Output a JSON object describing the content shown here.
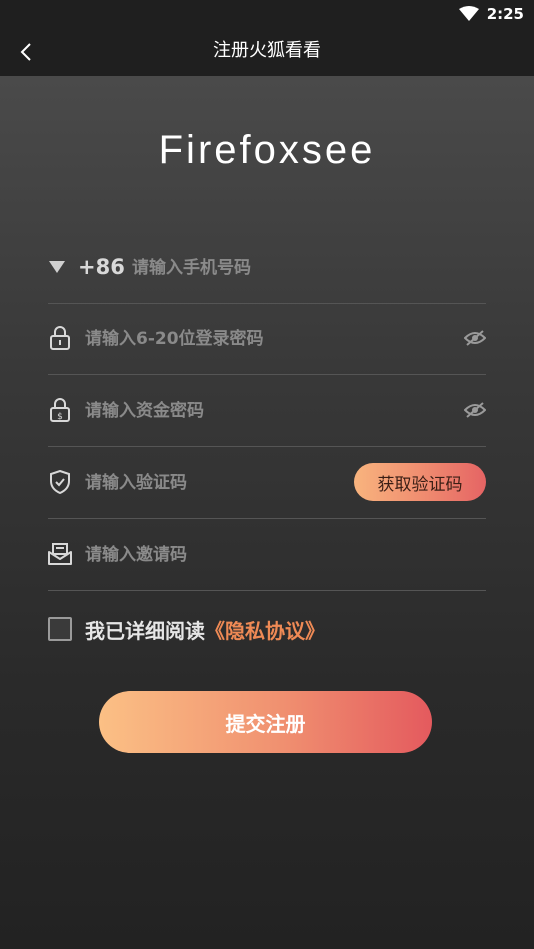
{
  "status_bar": {
    "time": "2:25"
  },
  "app_bar": {
    "title": "注册火狐看看"
  },
  "logo": {
    "text": "Firefoxsee"
  },
  "form": {
    "phone": {
      "country_code": "+86",
      "placeholder": "请输入手机号码"
    },
    "login_password": {
      "placeholder": "请输入6-20位登录密码"
    },
    "fund_password": {
      "placeholder": "请输入资金密码"
    },
    "verify_code": {
      "placeholder": "请输入验证码",
      "button_label": "获取验证码"
    },
    "invite_code": {
      "placeholder": "请输入邀请码"
    }
  },
  "agreement": {
    "text": "我已详细阅读",
    "link": "《隐私协议》"
  },
  "submit": {
    "label": "提交注册"
  }
}
